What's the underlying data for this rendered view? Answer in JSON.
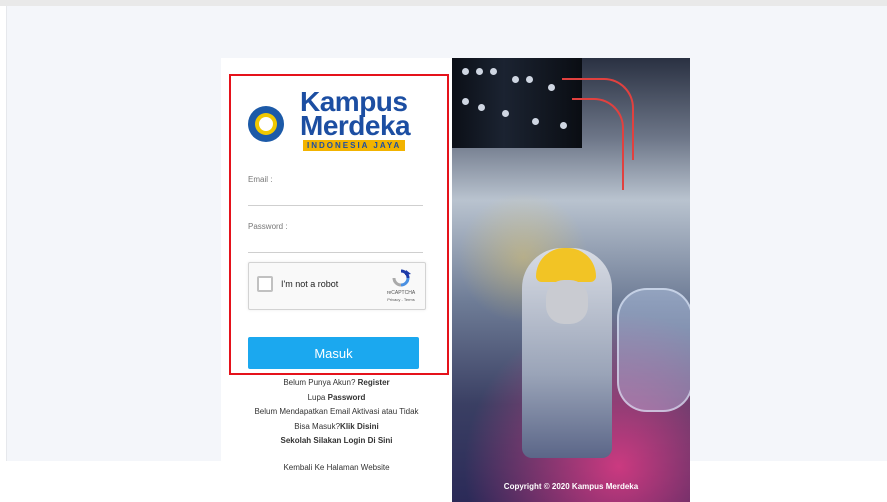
{
  "brand": {
    "line1": "Kampus",
    "line2": "Merdeka",
    "tagline": "INDONESIA JAYA"
  },
  "form": {
    "email_label": "Email :",
    "password_label": "Password :",
    "email_value": "",
    "password_value": "",
    "submit_label": "Masuk"
  },
  "recaptcha": {
    "label": "I'm not a robot",
    "brand": "reCAPTCHA",
    "links": "Privacy - Terms"
  },
  "links": {
    "no_account_text": "Belum Punya Akun? ",
    "register_link": "Register",
    "forgot_text": "Lupa ",
    "password_link": "Password",
    "activation_text_1": "Belum Mendapatkan Email Aktivasi atau Tidak",
    "activation_text_2": "Bisa Masuk?",
    "click_here_link": "Klik Disini",
    "school_login_link": "Sekolah Silakan Login Di Sini",
    "back_link": "Kembali Ke Halaman Website"
  },
  "footer": {
    "copyright": "Copyright © 2020 Kampus Merdeka"
  },
  "colors": {
    "brand_blue": "#1c4ea2",
    "button_blue": "#1ba8ef",
    "highlight_red": "#e5121b",
    "tagline_yellow": "#f2b300"
  }
}
